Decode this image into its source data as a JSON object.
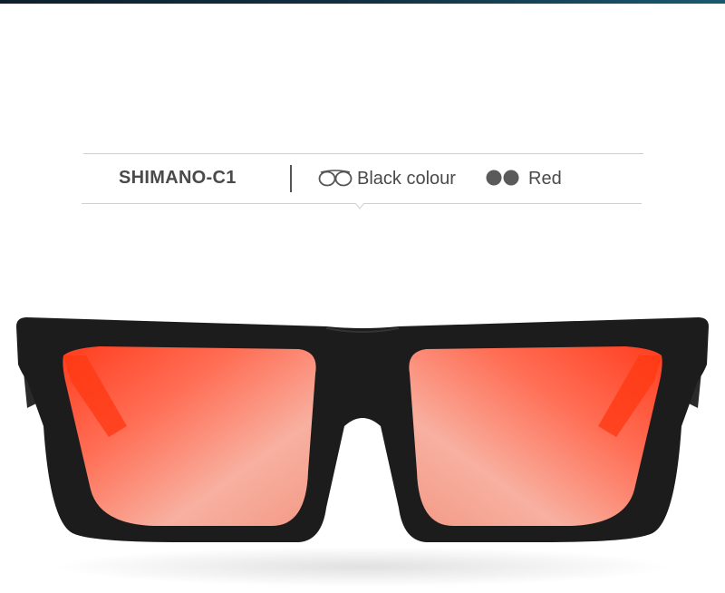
{
  "product": {
    "model_name": "SHIMANO-C1",
    "frame_label": "Black colour",
    "frame_icon": "glasses-outline-icon",
    "lens_label": "Red",
    "lens_icon": "glasses-filled-icon",
    "image_subject": "sunglasses",
    "frame_color": "#1c1c1c",
    "lens_color": "#ff5a3c"
  }
}
